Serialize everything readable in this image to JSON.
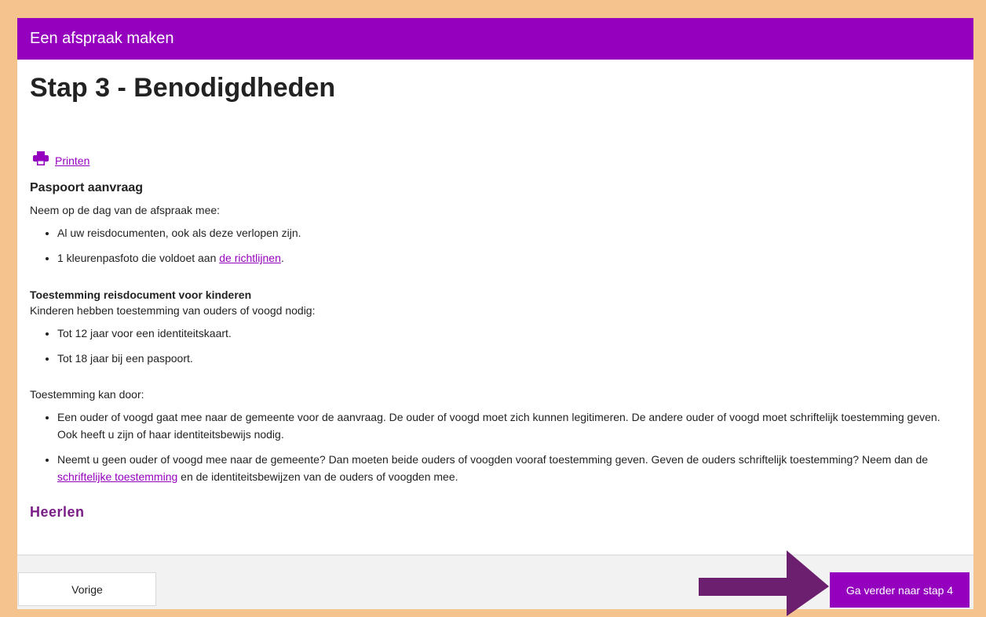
{
  "header": {
    "title": "Een afspraak maken"
  },
  "page": {
    "heading": "Stap 3 - Benodigdheden"
  },
  "print": {
    "label": "Printen",
    "icon": "printer-icon"
  },
  "passport": {
    "title": "Paspoort aanvraag",
    "intro": "Neem op de dag van de afspraak mee:",
    "item1": "Al uw reisdocumenten, ook als deze verlopen zijn.",
    "item2_prefix": "1 kleurenpasfoto die voldoet aan ",
    "item2_link": "de richtlijnen",
    "item2_suffix": "."
  },
  "children": {
    "title": "Toestemming reisdocument voor kinderen",
    "intro": "Kinderen hebben toestemming van ouders of voogd nodig:",
    "item1": "Tot 12 jaar voor een identiteitskaart.",
    "item2": "Tot 18 jaar bij een paspoort."
  },
  "consent": {
    "intro": "Toestemming kan door:",
    "item1": "Een ouder of voogd gaat mee naar de gemeente voor de aanvraag. De ouder of voogd moet zich kunnen legitimeren. De andere ouder of voogd moet schriftelijk toestemming geven. Ook heeft u zijn of haar identiteitsbewijs nodig.",
    "item2_prefix": "Neemt u geen ouder of voogd mee naar de gemeente? Dan moeten beide ouders of voogden vooraf toestemming geven. Geven de ouders schriftelijk toestemming? Neem dan de ",
    "item2_link": "schriftelijke toestemming",
    "item2_suffix": " en de identiteitsbewijzen van de ouders of voogden mee."
  },
  "brand": {
    "name": "Heerlen"
  },
  "footer": {
    "prev_label": "Vorige",
    "next_label": "Ga verder naar stap 4"
  },
  "colors": {
    "accent": "#9400bd",
    "page_border": "#f5c48e",
    "brand_text": "#7a1d86",
    "annotation_arrow": "#6b1f6e"
  }
}
